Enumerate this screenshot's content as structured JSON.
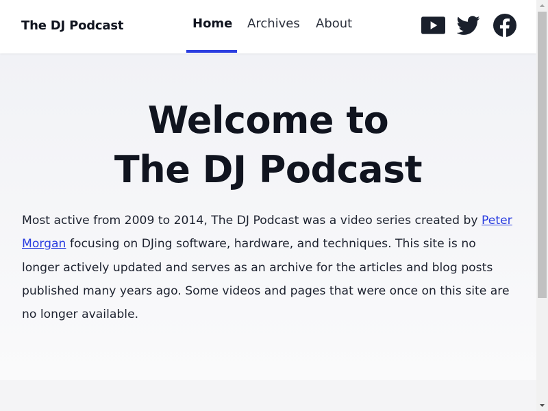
{
  "site": {
    "brand": "The DJ Podcast"
  },
  "nav": {
    "items": [
      {
        "label": "Home",
        "active": true
      },
      {
        "label": "Archives",
        "active": false
      },
      {
        "label": "About",
        "active": false
      }
    ],
    "accent_color": "#2b3ee0"
  },
  "social": [
    {
      "icon": "youtube-icon"
    },
    {
      "icon": "twitter-icon"
    },
    {
      "icon": "facebook-icon"
    }
  ],
  "hero": {
    "title_line1": "Welcome to",
    "title_line2": "The DJ Podcast",
    "text_before_link": "Most active from 2009 to 2014, The DJ Podcast was a video series created by ",
    "link_text": "Peter Morgan",
    "text_after_link": " focusing on DJing software, hardware, and techniques. This site is no longer actively updated and serves as an archive for the articles and blog posts published many years ago. Some videos and pages that were once on this site are no longer available."
  },
  "colors": {
    "text_dark": "#10141f",
    "link": "#2b3ee0",
    "background": "#f4f4f6"
  }
}
